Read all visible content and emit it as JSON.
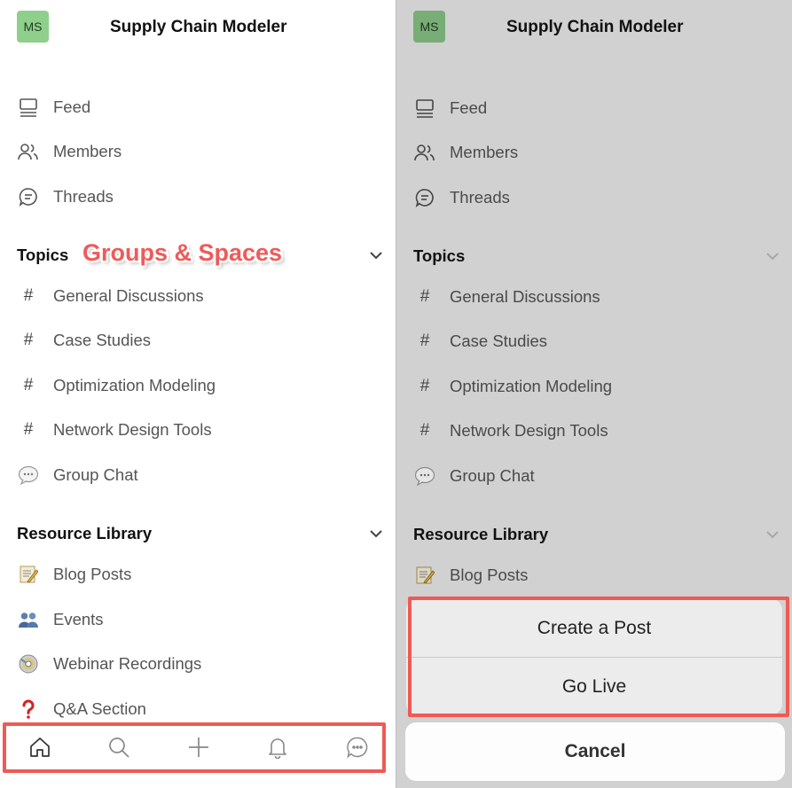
{
  "app": {
    "avatar_initials": "MS",
    "title": "Supply Chain Modeler"
  },
  "nav": [
    {
      "icon": "feed-icon",
      "label": "Feed"
    },
    {
      "icon": "members-icon",
      "label": "Members"
    },
    {
      "icon": "threads-icon",
      "label": "Threads"
    }
  ],
  "topics": {
    "title": "Topics",
    "items": [
      {
        "icon": "#",
        "label": "General Discussions"
      },
      {
        "icon": "#",
        "label": "Case Studies"
      },
      {
        "icon": "#",
        "label": "Optimization Modeling"
      },
      {
        "icon": "#",
        "label": "Network Design Tools"
      },
      {
        "icon": "speech-bubble-icon",
        "label": "Group Chat"
      }
    ]
  },
  "resources": {
    "title": "Resource Library",
    "items": [
      {
        "icon": "memo-icon",
        "label": "Blog Posts"
      },
      {
        "icon": "people-icon",
        "label": "Events"
      },
      {
        "icon": "disc-icon",
        "label": "Webinar Recordings"
      },
      {
        "icon": "question-icon",
        "label": "Q&A Section"
      }
    ]
  },
  "annotation": {
    "label": "Groups & Spaces",
    "color": "#ef5a5a"
  },
  "tabbar": [
    "home-icon",
    "search-icon",
    "plus-icon",
    "bell-icon",
    "chat-icon"
  ],
  "action_sheet": {
    "create_post": "Create a Post",
    "go_live": "Go Live",
    "cancel": "Cancel"
  }
}
